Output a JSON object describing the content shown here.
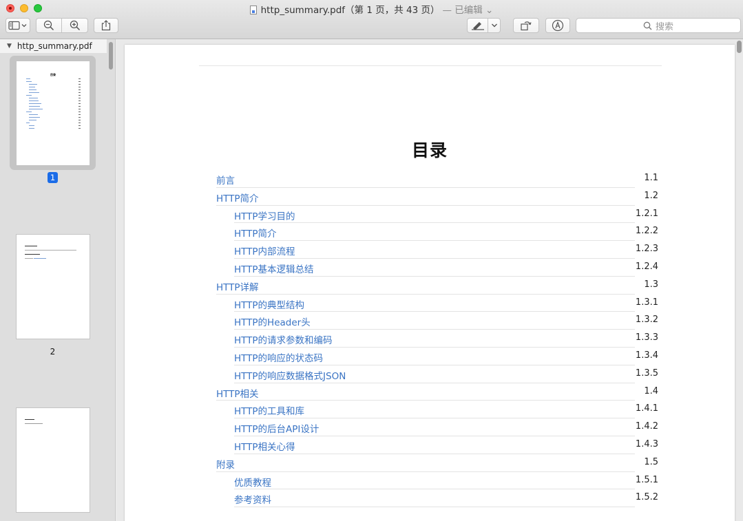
{
  "window": {
    "title": "http_summary.pdf（第 1 页，共 43 页）",
    "edited": "— 已编辑 ⌄"
  },
  "toolbar": {
    "search_placeholder": "搜索"
  },
  "sidebar": {
    "filename": "http_summary.pdf",
    "pages": [
      {
        "label": "1",
        "selected": true
      },
      {
        "label": "2",
        "selected": false
      }
    ]
  },
  "document": {
    "title": "目录",
    "toc": [
      {
        "label": "前言",
        "num": "1.1",
        "level": 1
      },
      {
        "label": "HTTP简介",
        "num": "1.2",
        "level": 1
      },
      {
        "label": "HTTP学习目的",
        "num": "1.2.1",
        "level": 2
      },
      {
        "label": "HTTP简介",
        "num": "1.2.2",
        "level": 2
      },
      {
        "label": "HTTP内部流程",
        "num": "1.2.3",
        "level": 2
      },
      {
        "label": "HTTP基本逻辑总结",
        "num": "1.2.4",
        "level": 2
      },
      {
        "label": "HTTP详解",
        "num": "1.3",
        "level": 1
      },
      {
        "label": "HTTP的典型结构",
        "num": "1.3.1",
        "level": 2
      },
      {
        "label": "HTTP的Header头",
        "num": "1.3.2",
        "level": 2
      },
      {
        "label": "HTTP的请求参数和编码",
        "num": "1.3.3",
        "level": 2
      },
      {
        "label": "HTTP的响应的状态码",
        "num": "1.3.4",
        "level": 2
      },
      {
        "label": "HTTP的响应数据格式JSON",
        "num": "1.3.5",
        "level": 2
      },
      {
        "label": "HTTP相关",
        "num": "1.4",
        "level": 1
      },
      {
        "label": "HTTP的工具和库",
        "num": "1.4.1",
        "level": 2
      },
      {
        "label": "HTTP的后台API设计",
        "num": "1.4.2",
        "level": 2
      },
      {
        "label": "HTTP相关心得",
        "num": "1.4.3",
        "level": 2
      },
      {
        "label": "附录",
        "num": "1.5",
        "level": 1
      },
      {
        "label": "优质教程",
        "num": "1.5.1",
        "level": 2
      },
      {
        "label": "参考资料",
        "num": "1.5.2",
        "level": 2
      }
    ]
  },
  "colors": {
    "link": "#3a74c4",
    "selection": "#1b6ce8"
  }
}
